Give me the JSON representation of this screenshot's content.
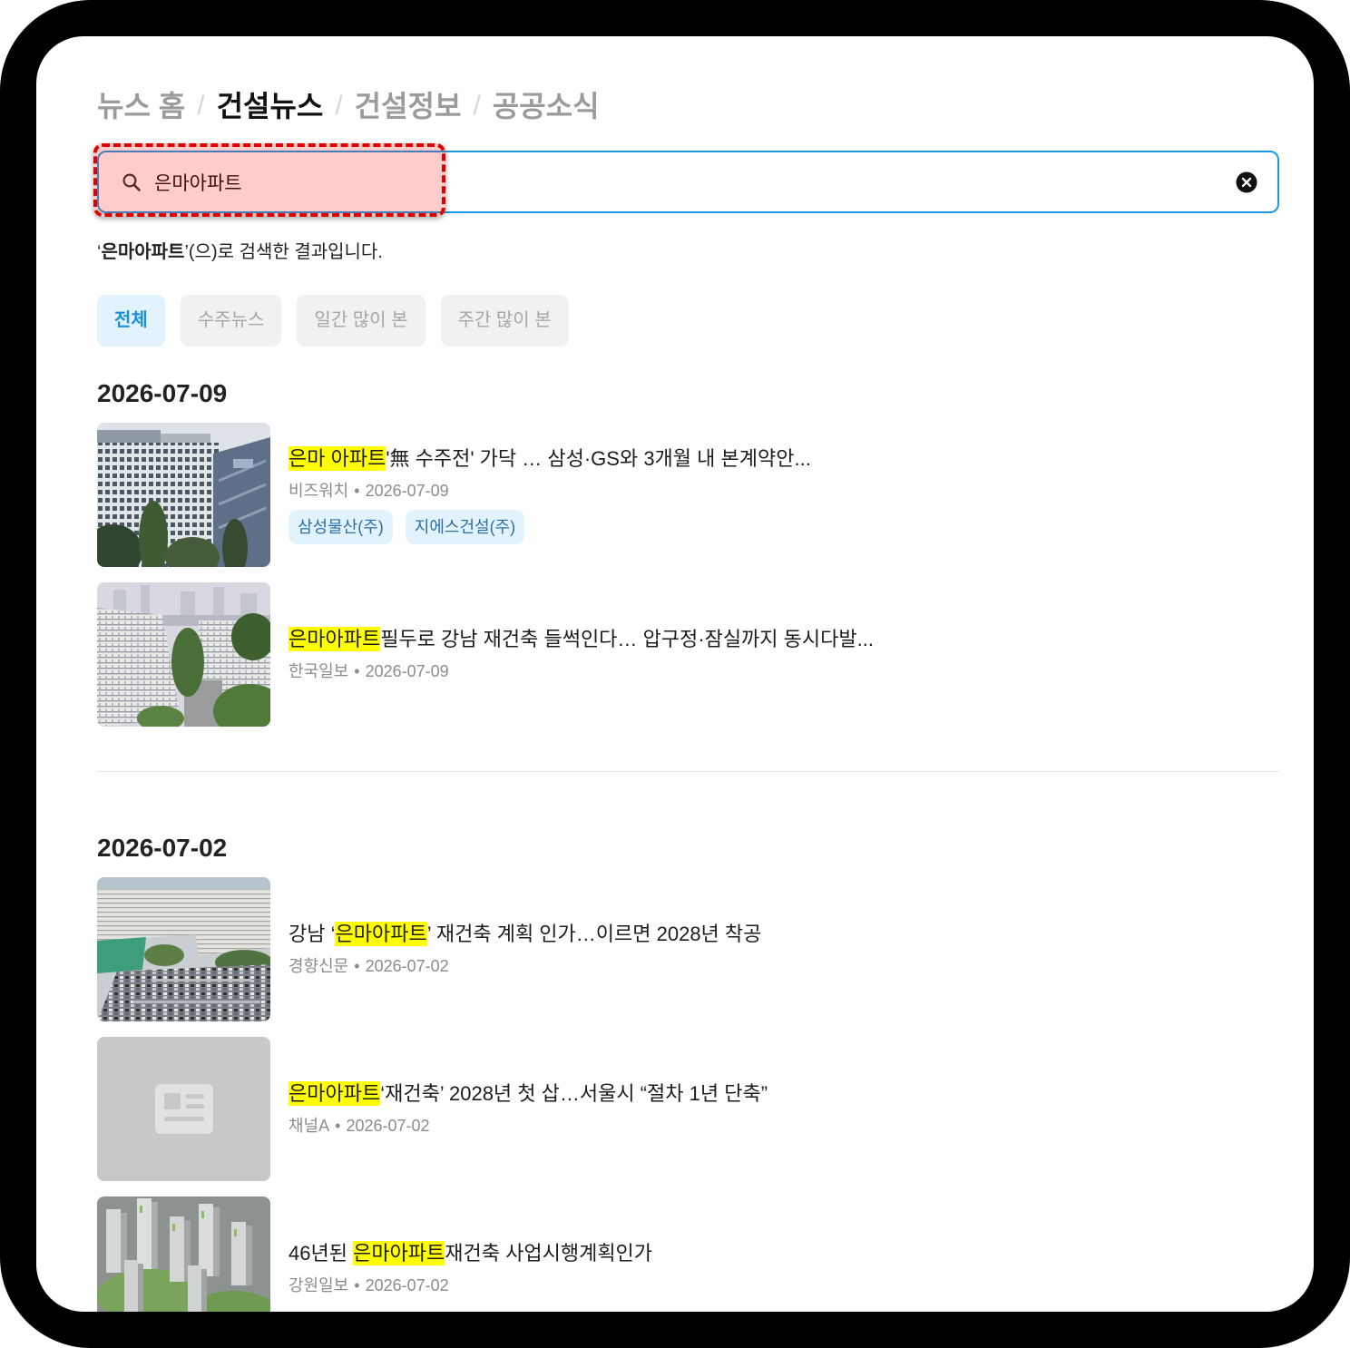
{
  "nav": {
    "tabs": [
      {
        "label": "뉴스 홈",
        "active": false
      },
      {
        "label": "건설뉴스",
        "active": true
      },
      {
        "label": "건설정보",
        "active": false
      },
      {
        "label": "공공소식",
        "active": false
      }
    ],
    "separator": "/"
  },
  "search": {
    "value": "은마아파트",
    "search_icon": "search-icon",
    "clear_icon": "clear-icon"
  },
  "result_summary": {
    "open_quote": "‘",
    "keyword": "은마아파트",
    "suffix": "’(으)로 검색한 결과입니다."
  },
  "filters": [
    {
      "label": "전체",
      "active": true
    },
    {
      "label": "수주뉴스",
      "active": false
    },
    {
      "label": "일간 많이 본",
      "active": false
    },
    {
      "label": "주간 많이 본",
      "active": false
    }
  ],
  "meta_separator": "•",
  "groups": [
    {
      "date": "2026-07-09",
      "articles": [
        {
          "title_prefix": "",
          "title_highlight": "은마 아파트",
          "title_suffix": "'無 수주전' 가닥 … 삼성·GS와 3개월 내 본계약안...",
          "source": "비즈워치",
          "date": "2026-07-09",
          "tags": [
            "삼성물산(주)",
            "지에스건설(주)"
          ]
        },
        {
          "title_prefix": "",
          "title_highlight": "은마아파트",
          "title_suffix": "필두로 강남 재건축 들썩인다… 압구정·잠실까지 동시다발...",
          "source": "한국일보",
          "date": "2026-07-09"
        }
      ]
    },
    {
      "date": "2026-07-02",
      "articles": [
        {
          "title_prefix": "강남 ‘",
          "title_highlight": "은마아파트",
          "title_suffix": "’ 재건축 계획 인가…이르면 2028년 착공",
          "source": "경향신문",
          "date": "2026-07-02"
        },
        {
          "title_prefix": "",
          "title_highlight": "은마아파트",
          "title_suffix": "‘재건축’ 2028년 첫 삽…서울시 “절차 1년 단축”",
          "source": "채널A",
          "date": "2026-07-02",
          "thumbnail_icon": "newspaper-icon"
        },
        {
          "title_prefix": "46년된 ",
          "title_highlight": "은마아파트",
          "title_suffix": "재건축 사업시행계획인가",
          "source": "강원일보",
          "date": "2026-07-02"
        }
      ]
    }
  ],
  "colors": {
    "accent": "#1a9be6",
    "active_chip_text": "#1a8fe0",
    "active_chip_bg": "#e2f3fd",
    "keyword_highlight": "#ffff00",
    "tag_bg": "#e3f3fd",
    "tag_text": "#2b6fa6",
    "annotation": "#e00000"
  }
}
